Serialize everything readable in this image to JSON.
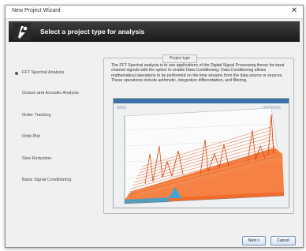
{
  "window": {
    "title": "New Project Wizard",
    "close_glyph": "✕"
  },
  "header": {
    "title": "Select a project type for analysis",
    "icon": "wizard-logo-icon"
  },
  "options": [
    {
      "label": "FFT Spectral Analysis",
      "selected": true
    },
    {
      "label": "Octave and Acoustic Analysis",
      "selected": false
    },
    {
      "label": "Order Tracking",
      "selected": false
    },
    {
      "label": "Orbit Plot",
      "selected": false
    },
    {
      "label": "Sine Reduction",
      "selected": false
    },
    {
      "label": "Basic Signal Conditioning",
      "selected": false
    }
  ],
  "panel": {
    "legend": "Project type",
    "description": "The FFT Spectral analysis is to use applications of the Digital Signal Processing theory for input channel signals with the option to enable Data Conditioning. Data Conditioning allows mathematical operations to be performed on the time streams from the data source or sources. These operations include arithmetic, integration differentiation, and filtering."
  },
  "buttons": {
    "next": "Next >",
    "cancel": "Cancel"
  },
  "colors": {
    "accent": "#e8682c",
    "header_bg": "#2a2a2a",
    "trace_blue": "#3aa6d8"
  }
}
